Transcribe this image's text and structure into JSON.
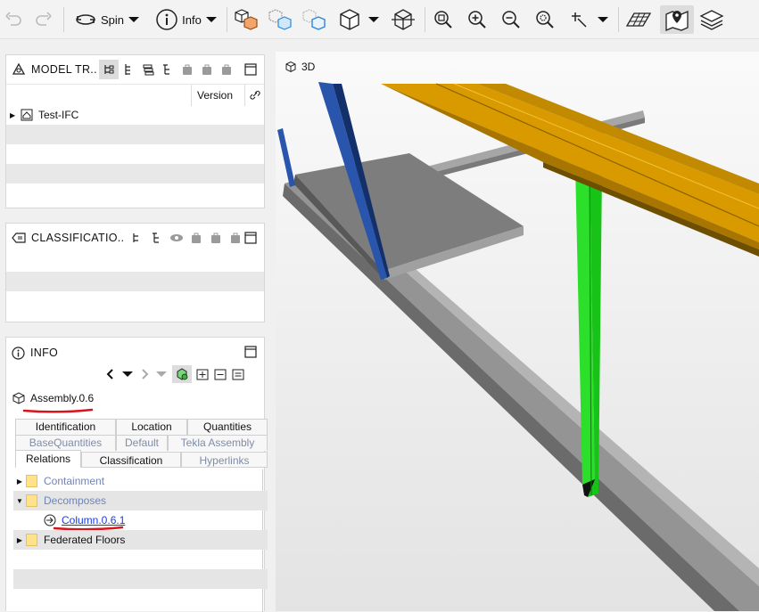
{
  "toolbar": {
    "spin_label": "Spin",
    "info_label": "Info",
    "icons": [
      "undo-icon",
      "redo-icon",
      "spin-icon",
      "info-icon",
      "box-select-icon",
      "ghost-icon",
      "selection-box-icon",
      "cube-view-icon",
      "section-icon",
      "zoom-fit-icon",
      "zoom-in-icon",
      "zoom-out-icon",
      "zoom-selection-icon",
      "pick-icon",
      "grid-icon",
      "map-pin-icon",
      "layers-icon"
    ]
  },
  "model_tree": {
    "title": "MODEL TR..",
    "column_version": "Version",
    "items": [
      {
        "label": "Test-IFC"
      }
    ]
  },
  "classification": {
    "title": "CLASSIFICATIO.."
  },
  "info": {
    "title": "INFO",
    "selected": "Assembly.0.6",
    "tabs_row1": [
      "Identification",
      "Location",
      "Quantities"
    ],
    "tabs_row2": [
      "BaseQuantities",
      "Default",
      "Tekla Assembly"
    ],
    "tabs_row3": [
      "Relations",
      "Classification",
      "Hyperlinks"
    ],
    "tree": [
      {
        "label": "Containment",
        "expanded": false
      },
      {
        "label": "Decomposes",
        "expanded": true
      },
      {
        "label": "Column.0.6.1",
        "child": true
      },
      {
        "label": "Federated Floors",
        "expanded": false
      }
    ]
  },
  "viewport": {
    "label": "3D"
  },
  "colors": {
    "beam_orange": "#e0a000",
    "column_green": "#22dd22",
    "column_blue": "#244a99",
    "slab_gray": "#7d7d7d",
    "annotation_red": "#d8141c"
  }
}
